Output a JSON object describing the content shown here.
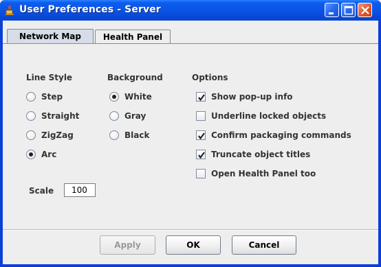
{
  "window": {
    "title": "User Preferences - Server",
    "icon": "java-cup-icon"
  },
  "tabs": [
    {
      "label": "Network Map",
      "active": true
    },
    {
      "label": "Health Panel",
      "active": false
    }
  ],
  "line_style": {
    "heading": "Line Style",
    "options": [
      {
        "label": "Step",
        "selected": false
      },
      {
        "label": "Straight",
        "selected": false
      },
      {
        "label": "ZigZag",
        "selected": false
      },
      {
        "label": "Arc",
        "selected": true
      }
    ]
  },
  "background": {
    "heading": "Background",
    "options": [
      {
        "label": "White",
        "selected": true
      },
      {
        "label": "Gray",
        "selected": false
      },
      {
        "label": "Black",
        "selected": false
      }
    ]
  },
  "options": {
    "heading": "Options",
    "items": [
      {
        "label": "Show pop-up info",
        "checked": true
      },
      {
        "label": "Underline locked objects",
        "checked": false
      },
      {
        "label": "Confirm packaging commands",
        "checked": true
      },
      {
        "label": "Truncate object titles",
        "checked": true
      },
      {
        "label": "Open Health Panel too",
        "checked": false
      }
    ]
  },
  "scale": {
    "label": "Scale",
    "value": "100"
  },
  "buttons": {
    "apply": "Apply",
    "ok": "OK",
    "cancel": "Cancel"
  }
}
